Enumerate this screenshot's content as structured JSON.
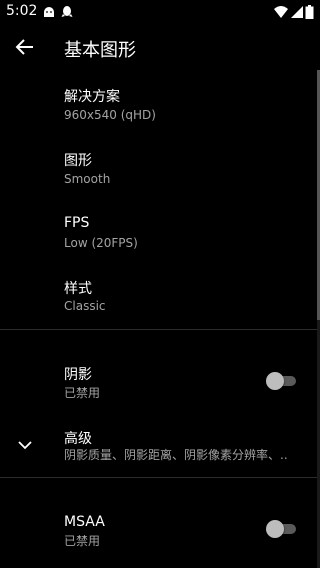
{
  "status_bar": {
    "time": "5:02",
    "left_icons": [
      "android-notification-icon",
      "qq-notification-icon"
    ],
    "right_icons": [
      "wifi-icon",
      "signal-icon",
      "battery-icon"
    ]
  },
  "app_bar": {
    "back_icon": "arrow-left-icon",
    "title": "基本图形"
  },
  "settings": {
    "resolution": {
      "label": "解决方案",
      "value": "960x540 (qHD)"
    },
    "graphics": {
      "label": "图形",
      "value": "Smooth"
    },
    "fps": {
      "label": "FPS",
      "value": "Low (20FPS)"
    },
    "style": {
      "label": "样式",
      "value": "Classic"
    },
    "shadows": {
      "label": "阴影",
      "value": "已禁用",
      "enabled": false
    },
    "advanced": {
      "label": "高级",
      "value": "阴影质量、阴影距离、阴影像素分辨率、..",
      "icon": "chevron-down-icon"
    },
    "msaa": {
      "label": "MSAA",
      "value": "已禁用",
      "enabled": false
    }
  },
  "colors": {
    "background": "#000000",
    "primary_text": "#ffffff",
    "secondary_text": "#a3a3a3",
    "divider": "#2c2c2c",
    "toggle_track_off": "#5a5a5a",
    "toggle_knob_off": "#bdbdbd"
  }
}
